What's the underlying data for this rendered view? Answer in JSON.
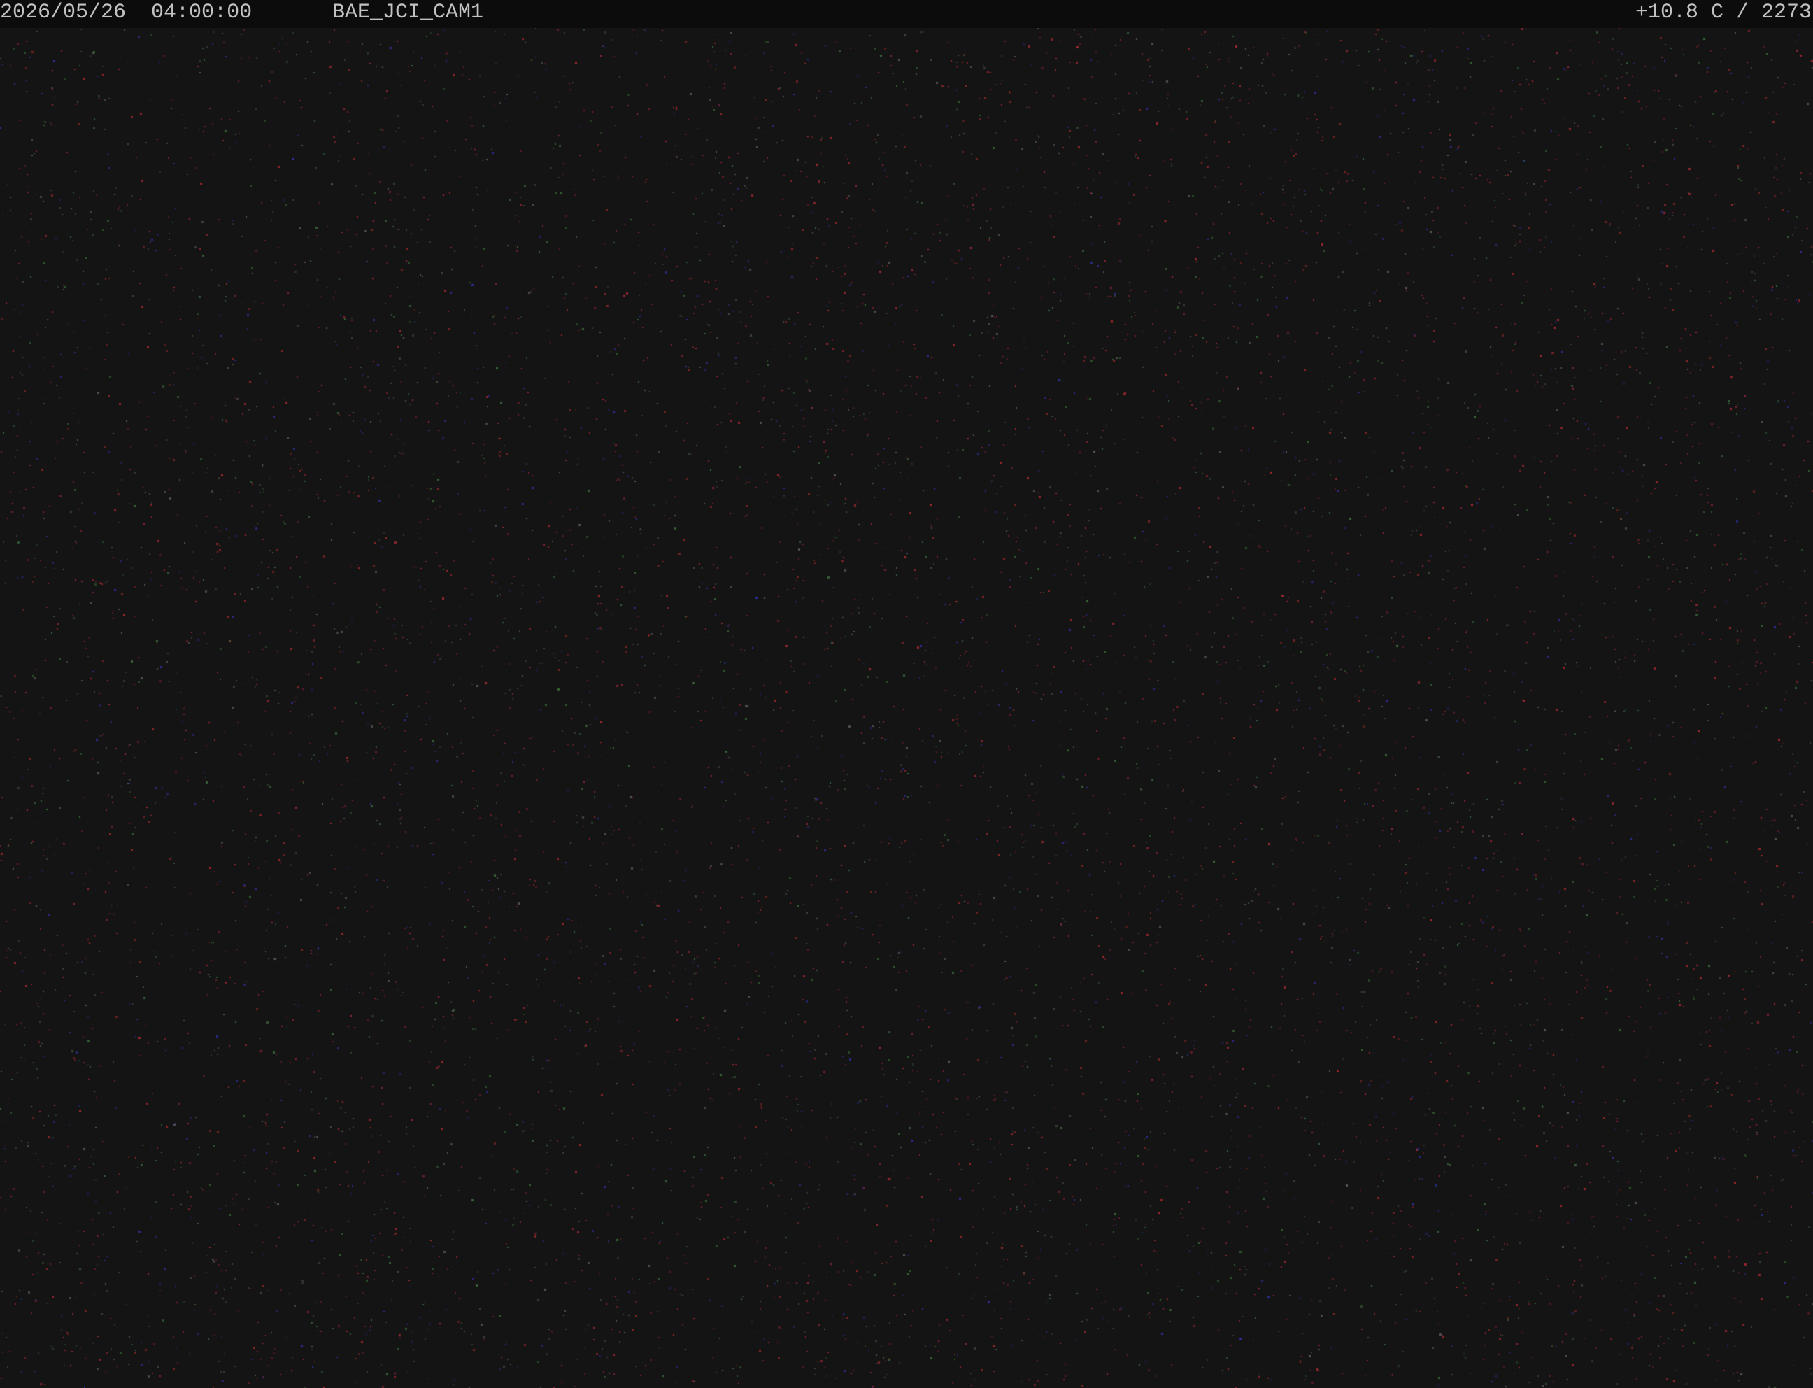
{
  "osd": {
    "date": "2026/05/26",
    "time": "04:00:00",
    "camera_id": "BAE_JCI_CAM1",
    "temperature": "+10.8 C",
    "counter": "2273"
  },
  "colors": {
    "background": "#141414",
    "osd_bar": "#0c0c0c",
    "osd_text": "#c2c2c2",
    "noise_red": "#a02830",
    "noise_green": "#3a6a3a",
    "noise_blue": "#3030a0"
  }
}
